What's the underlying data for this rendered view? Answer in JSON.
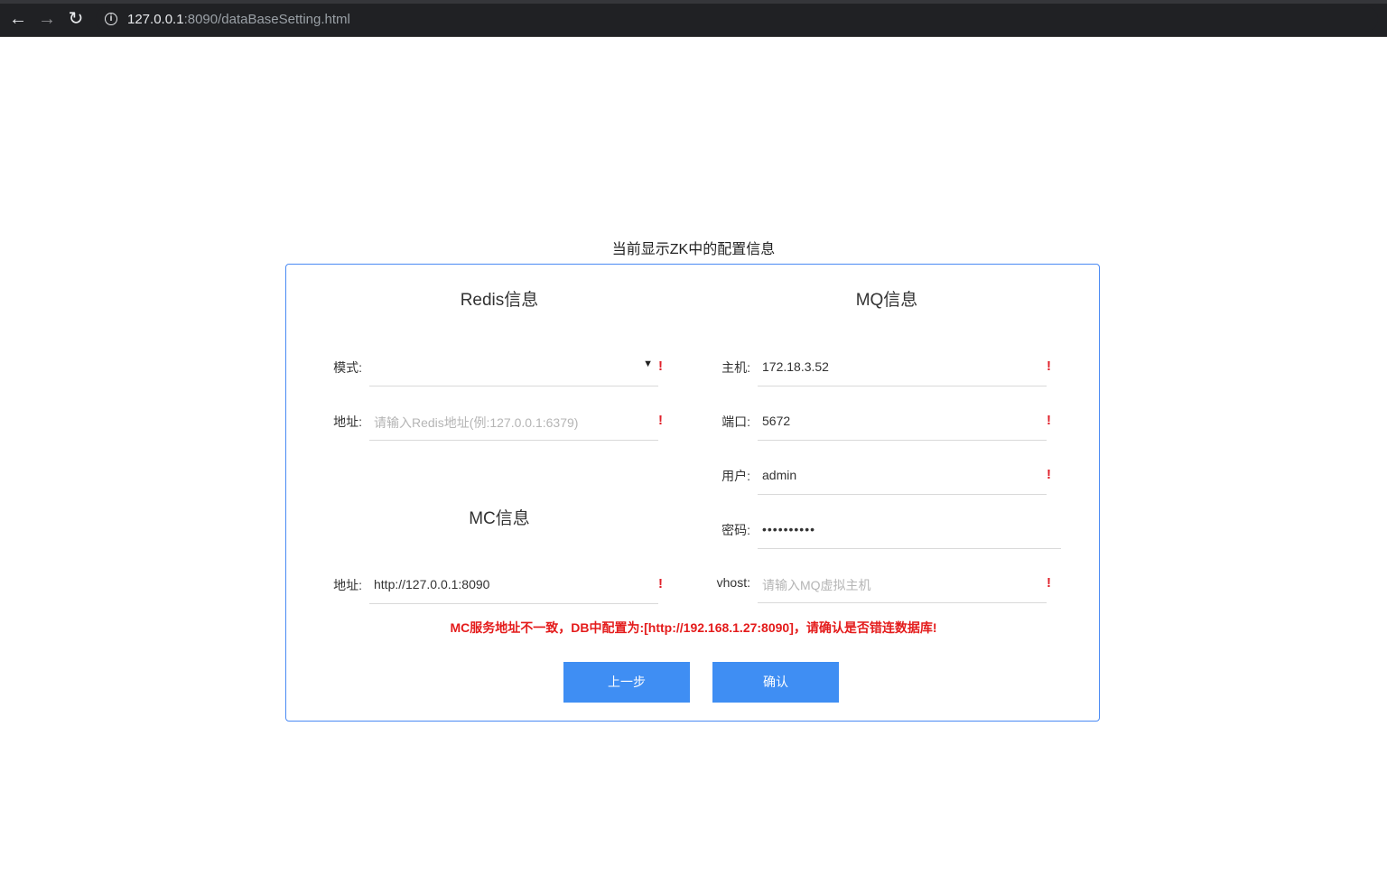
{
  "browser": {
    "url_host": "127.0.0.1",
    "url_rest": ":8090/dataBaseSetting.html"
  },
  "page": {
    "title": "当前显示ZK中的配置信息"
  },
  "redis": {
    "title": "Redis信息",
    "mode_label": "模式:",
    "mode_value": "",
    "address_label": "地址:",
    "address_placeholder": "请输入Redis地址(例:127.0.0.1:6379)"
  },
  "mc": {
    "title": "MC信息",
    "address_label": "地址:",
    "address_value": "http://127.0.0.1:8090"
  },
  "mq": {
    "title": "MQ信息",
    "host_label": "主机:",
    "host_value": "172.18.3.52",
    "port_label": "端口:",
    "port_value": "5672",
    "user_label": "用户:",
    "user_value": "admin",
    "password_label": "密码:",
    "password_value": "••••••••••",
    "vhost_label": "vhost:",
    "vhost_placeholder": "请输入MQ虚拟主机"
  },
  "required_mark": "!",
  "error_message": "MC服务地址不一致，DB中配置为:[http://192.168.1.27:8090]，请确认是否错连数据库!",
  "buttons": {
    "prev_label": "上一步",
    "confirm_label": "确认"
  },
  "colors": {
    "accent": "#3f8ef3",
    "panel_border": "#4a8af4",
    "error": "#e41b1b"
  }
}
